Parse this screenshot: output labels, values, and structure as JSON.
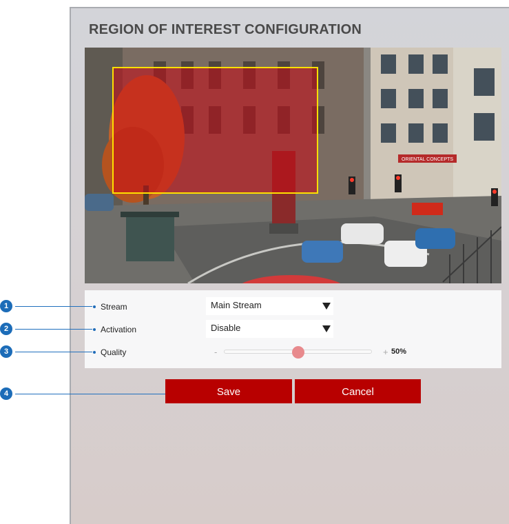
{
  "page": {
    "title": "REGION OF INTEREST CONFIGURATION"
  },
  "video": {
    "storefront_text": "ORIENTAL CONCEPTS"
  },
  "callouts": [
    "1",
    "2",
    "3",
    "4"
  ],
  "form": {
    "stream": {
      "label": "Stream",
      "value": "Main Stream"
    },
    "activation": {
      "label": "Activation",
      "value": "Disable"
    },
    "quality": {
      "label": "Quality",
      "minus": "-",
      "plus": "+",
      "value_text": "50%",
      "value": 0.5
    }
  },
  "buttons": {
    "save": "Save",
    "cancel": "Cancel"
  },
  "colors": {
    "accent": "#b80000",
    "roi_fill": "#c80a14",
    "roi_border": "#ffe000",
    "callout": "#1c6cb8"
  }
}
